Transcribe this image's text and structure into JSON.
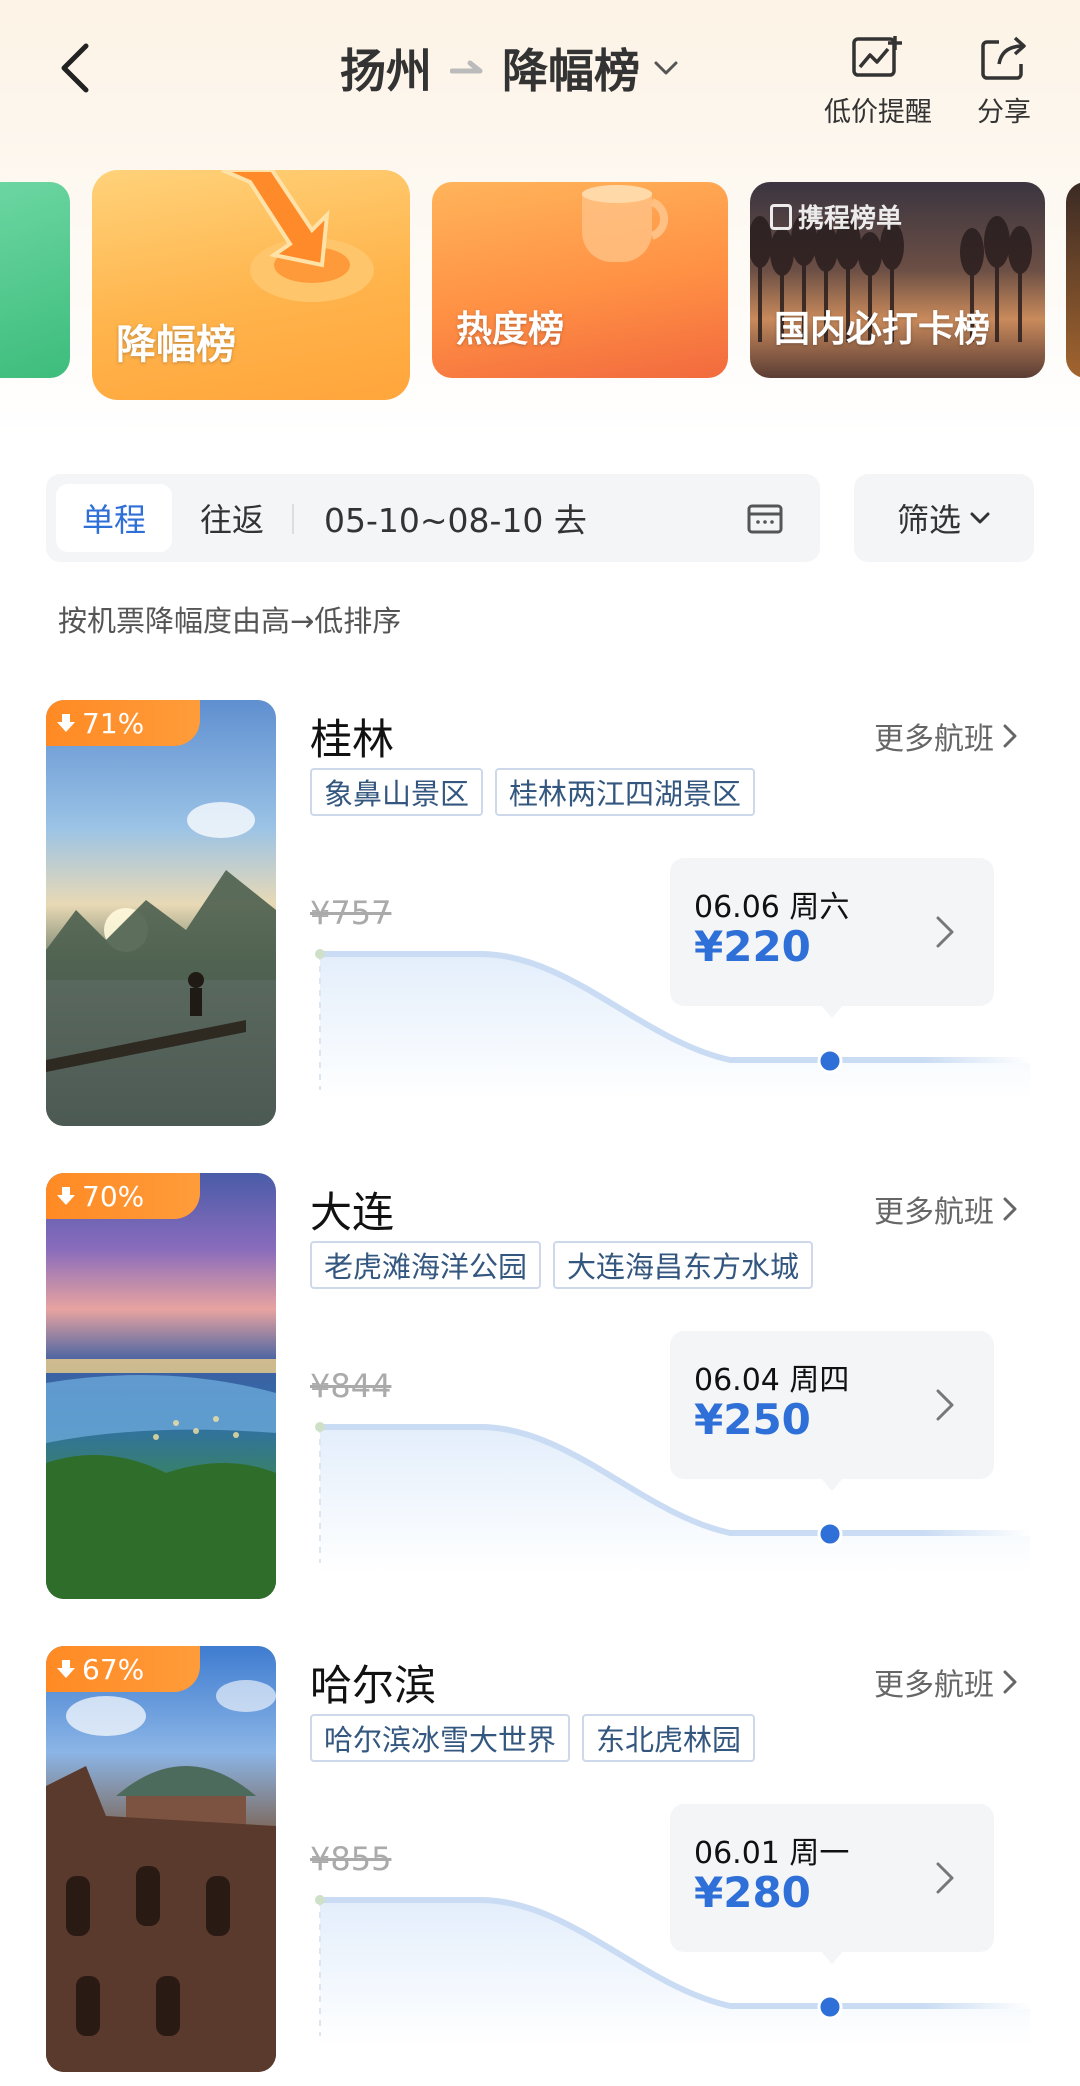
{
  "header": {
    "origin": "扬州",
    "list_name": "降幅榜",
    "actions": [
      {
        "label": "低价提醒",
        "icon": "price-alert-icon"
      },
      {
        "label": "分享",
        "icon": "share-icon"
      }
    ]
  },
  "rank_cards": [
    {
      "label": "降幅榜",
      "active": true
    },
    {
      "label": "热度榜",
      "active": false
    },
    {
      "label": "国内必打卡榜",
      "brand": "携程榜单",
      "active": false
    }
  ],
  "filter": {
    "trip_types": [
      "单程",
      "往返"
    ],
    "selected": "单程",
    "date_range": "05-10~08-10 去",
    "filter_label": "筛选"
  },
  "sort_note": "按机票降幅度由高→低排序",
  "more_label": "更多航班",
  "items": [
    {
      "city": "桂林",
      "badge": "71%",
      "tags": [
        "象鼻山景区",
        "桂林两江四湖景区"
      ],
      "old_price": "¥757",
      "date": "06.06 周六",
      "price": "¥220"
    },
    {
      "city": "大连",
      "badge": "70%",
      "tags": [
        "老虎滩海洋公园",
        "大连海昌东方水城"
      ],
      "old_price": "¥844",
      "date": "06.04 周四",
      "price": "¥250"
    },
    {
      "city": "哈尔滨",
      "badge": "67%",
      "tags": [
        "哈尔滨冰雪大世界",
        "东北虎林园"
      ],
      "old_price": "¥855",
      "date": "06.01 周一",
      "price": "¥280"
    }
  ],
  "colors": {
    "accent_blue": "#2f6fd8",
    "badge_orange": "#ff8a24"
  }
}
